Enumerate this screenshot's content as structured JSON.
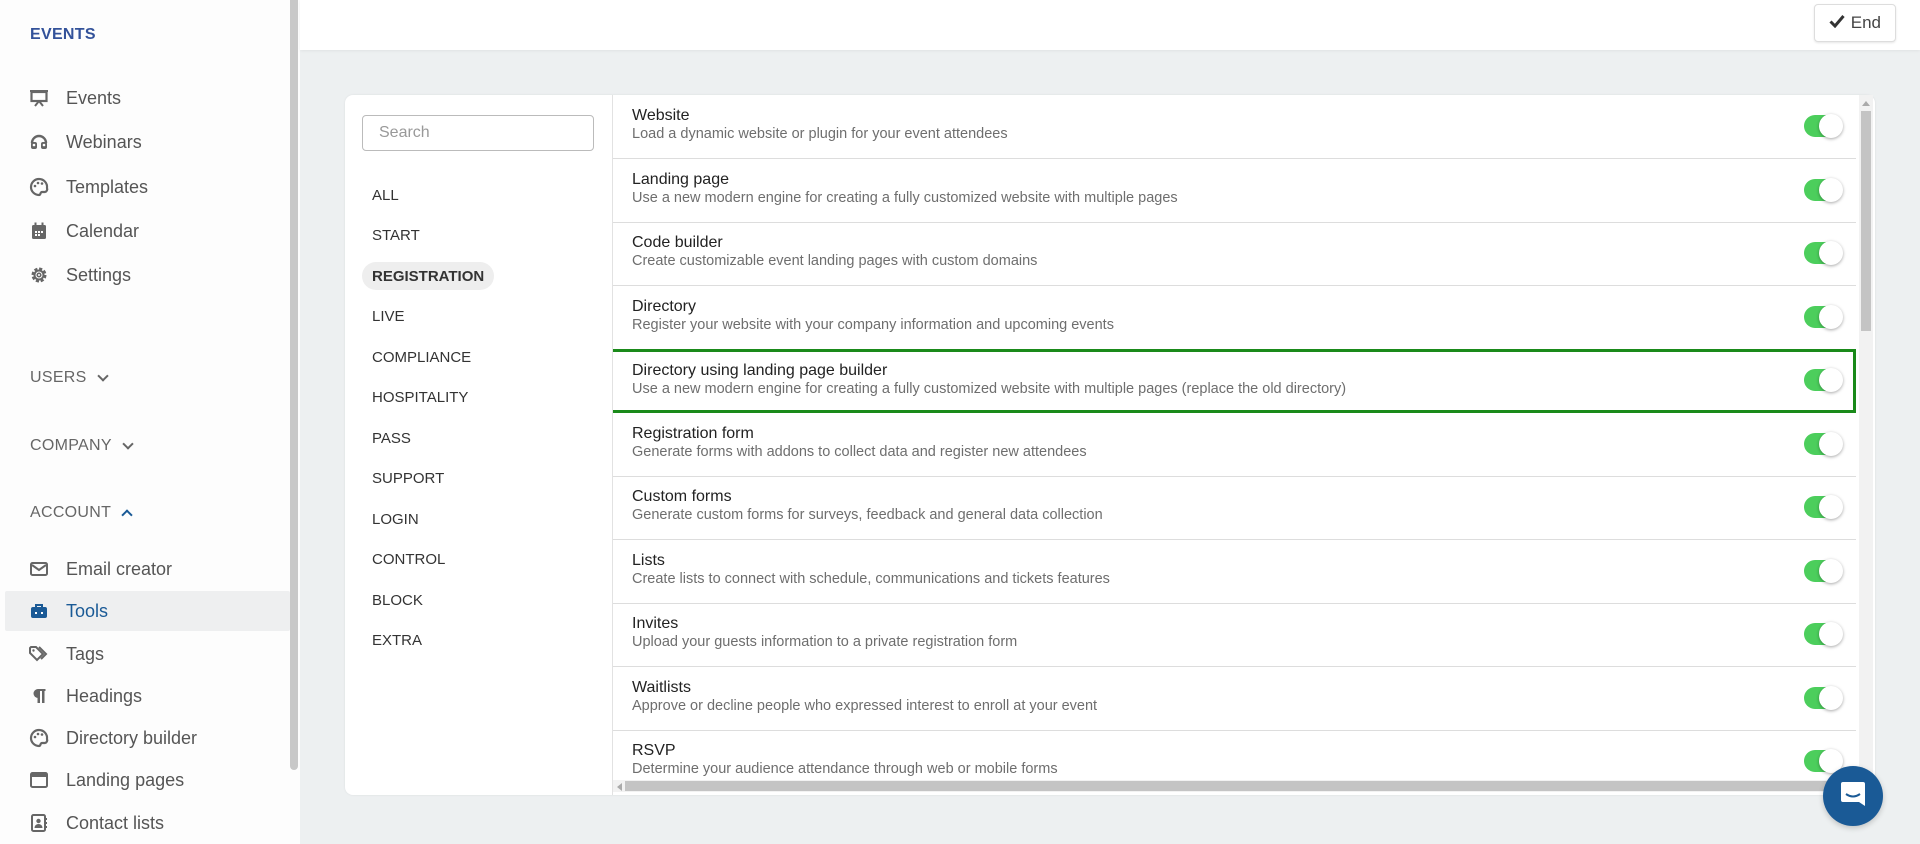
{
  "sidebar": {
    "events_section": "EVENTS",
    "events_items": [
      {
        "label": "Events",
        "icon": "presentation-icon"
      },
      {
        "label": "Webinars",
        "icon": "headset-icon"
      },
      {
        "label": "Templates",
        "icon": "palette-icon"
      },
      {
        "label": "Calendar",
        "icon": "calendar-icon"
      },
      {
        "label": "Settings",
        "icon": "gear-icon"
      }
    ],
    "users_section": "USERS",
    "company_section": "COMPANY",
    "account_section": "ACCOUNT",
    "account_items": [
      {
        "label": "Email creator",
        "icon": "envelope-icon"
      },
      {
        "label": "Tools",
        "icon": "toolbox-icon",
        "active": true
      },
      {
        "label": "Tags",
        "icon": "tags-icon"
      },
      {
        "label": "Headings",
        "icon": "paragraph-icon"
      },
      {
        "label": "Directory builder",
        "icon": "palette-icon"
      },
      {
        "label": "Landing pages",
        "icon": "window-icon"
      },
      {
        "label": "Contact lists",
        "icon": "address-book-icon"
      }
    ]
  },
  "topbar": {
    "end_label": "End",
    "end_icon": "check-icon"
  },
  "filters": {
    "search_placeholder": "Search",
    "search_value": "",
    "categories": [
      "ALL",
      "START",
      "REGISTRATION",
      "LIVE",
      "COMPLIANCE",
      "HOSPITALITY",
      "PASS",
      "SUPPORT",
      "LOGIN",
      "CONTROL",
      "BLOCK",
      "EXTRA"
    ],
    "active_category": "REGISTRATION"
  },
  "tools": [
    {
      "title": "Website",
      "description": "Load a dynamic website or plugin for your event attendees",
      "enabled": true
    },
    {
      "title": "Landing page",
      "description": "Use a new modern engine for creating a fully customized website with multiple pages",
      "enabled": true
    },
    {
      "title": "Code builder",
      "description": "Create customizable event landing pages with custom domains",
      "enabled": true
    },
    {
      "title": "Directory",
      "description": "Register your website with your company information and upcoming events",
      "enabled": true
    },
    {
      "title": "Directory using landing page builder",
      "description": "Use a new modern engine for creating a fully customized website with multiple pages (replace the old directory)",
      "enabled": true,
      "highlighted": true
    },
    {
      "title": "Registration form",
      "description": "Generate forms with addons to collect data and register new attendees",
      "enabled": true
    },
    {
      "title": "Custom forms",
      "description": "Generate custom forms for surveys, feedback and general data collection",
      "enabled": true
    },
    {
      "title": "Lists",
      "description": "Create lists to connect with schedule, communications and tickets features",
      "enabled": true
    },
    {
      "title": "Invites",
      "description": "Upload your guests information to a private registration form",
      "enabled": true
    },
    {
      "title": "Waitlists",
      "description": "Approve or decline people who expressed interest to enroll at your event",
      "enabled": true
    },
    {
      "title": "RSVP",
      "description": "Determine your audience attendance through web or mobile forms",
      "enabled": true
    }
  ],
  "colors": {
    "brand": "#1a5a96",
    "section_title": "#33529a",
    "toggle_on": "#4cce5c",
    "highlight_border": "#1a8a1a"
  },
  "chat": {
    "icon": "chat-icon"
  }
}
